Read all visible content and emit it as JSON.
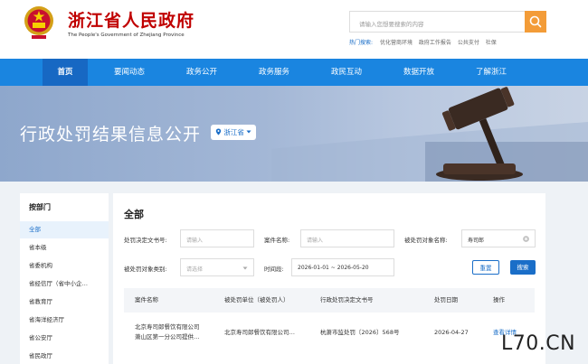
{
  "header": {
    "site_title": "浙江省人民政府",
    "site_subtitle": "The People's Government of Zhejiang Province",
    "search": {
      "placeholder": "请输入您想要搜索的内容"
    },
    "hot_label": "热门搜索:",
    "hot_items": [
      "优化营商环境",
      "政府工作报告",
      "公共支付",
      "社保"
    ]
  },
  "nav": {
    "items": [
      {
        "label": "首页",
        "active": true
      },
      {
        "label": "要闻动态"
      },
      {
        "label": "政务公开"
      },
      {
        "label": "政务服务"
      },
      {
        "label": "政民互动"
      },
      {
        "label": "数据开放"
      },
      {
        "label": "了解浙江"
      }
    ]
  },
  "banner": {
    "title": "行政处罚结果信息公开",
    "region": "浙江省"
  },
  "sidebar": {
    "heading": "按部门",
    "items": [
      {
        "label": "全部",
        "active": true
      },
      {
        "label": "省本级"
      },
      {
        "label": "省委机构"
      },
      {
        "label": "省经信厅（省中小企…"
      },
      {
        "label": "省教育厅"
      },
      {
        "label": "省海洋经济厅"
      },
      {
        "label": "省公安厅"
      },
      {
        "label": "省民政厅"
      }
    ]
  },
  "filters": {
    "title": "全部",
    "decision_no_label": "处罚决定文书号:",
    "decision_no_placeholder": "请输入",
    "case_name_label": "案件名称:",
    "case_name_placeholder": "请输入",
    "party_name_label": "被处罚对象名称:",
    "party_name_value": "寿司郎",
    "party_type_label": "被处罚对象类别:",
    "party_type_placeholder": "请选择",
    "time_label": "时间段:",
    "time_value": "2026-01-01 ~ 2026-05-20",
    "reset_label": "重置",
    "search_label": "搜索"
  },
  "table": {
    "headers": [
      "案件名称",
      "被处罚单位（被处罚人）",
      "行政处罚决定文书号",
      "处罚日期",
      "操作"
    ],
    "rows": [
      {
        "case_name_line1": "北京寿司郎餐饮有限公司",
        "case_name_line2": "萧山区第一分公司提供…",
        "party": "北京寿司郎餐饮有限公司…",
        "decision_no": "杭萧市监处罚〔2026〕568号",
        "date": "2026-04-27",
        "action": "查看详情"
      }
    ]
  },
  "watermark": "L70.CN",
  "colors": {
    "brand_red": "#c00000",
    "nav_blue": "#1a85e0",
    "nav_active": "#1768c3",
    "link_blue": "#1a6ec8",
    "search_orange": "#f39c38"
  },
  "icons": [
    "national-emblem-icon",
    "search-icon",
    "location-pin-icon",
    "caret-down-icon",
    "clear-icon",
    "calendar-icon"
  ]
}
